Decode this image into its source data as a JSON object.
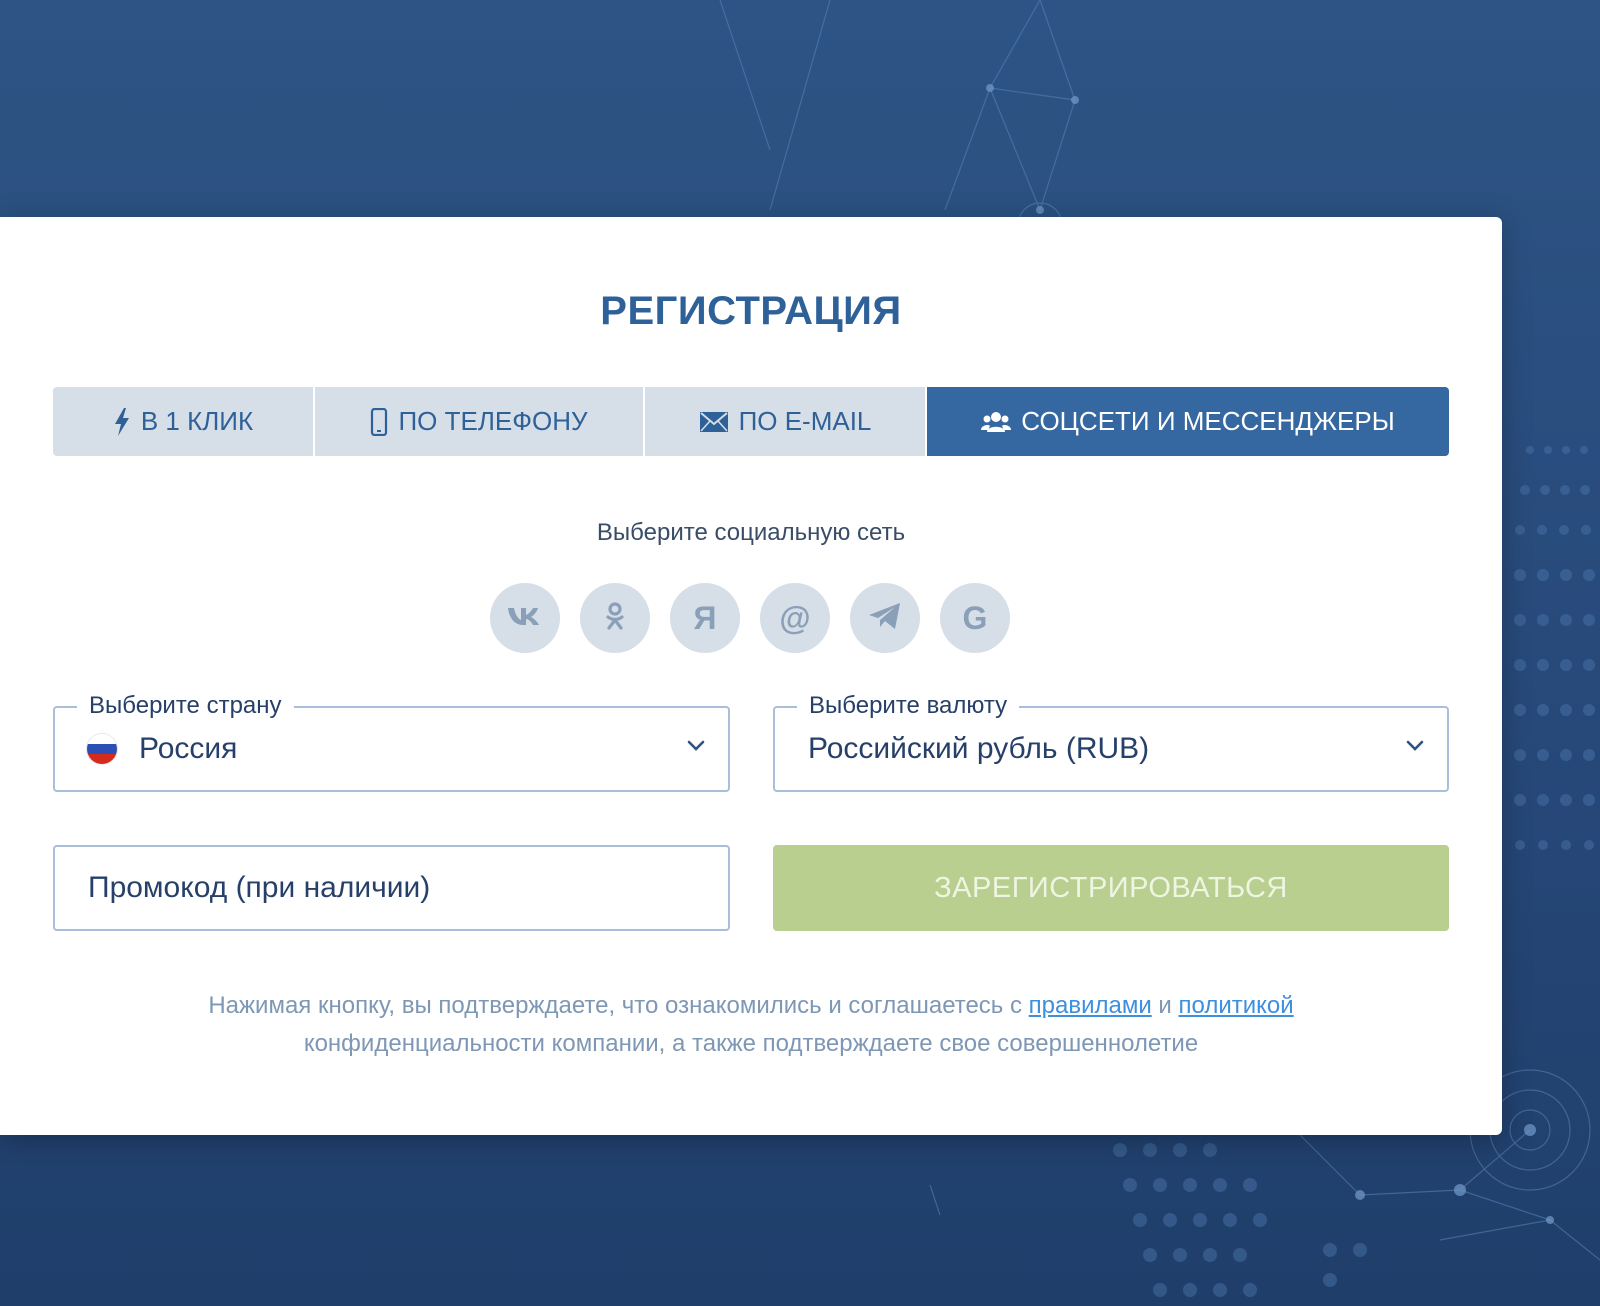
{
  "modal": {
    "title": "РЕГИСТРАЦИЯ"
  },
  "tabs": [
    {
      "label": "В 1 КЛИК",
      "icon": "lightning-icon",
      "active": false
    },
    {
      "label": "ПО ТЕЛЕФОНУ",
      "icon": "phone-icon",
      "active": false
    },
    {
      "label": "ПО E-MAIL",
      "icon": "envelope-icon",
      "active": false
    },
    {
      "label": "СОЦСЕТИ И МЕССЕНДЖЕРЫ",
      "icon": "users-icon",
      "active": true
    }
  ],
  "social": {
    "prompt": "Выберите социальную сеть",
    "networks": [
      {
        "icon": "vk-icon"
      },
      {
        "icon": "odnoklassniki-icon"
      },
      {
        "icon": "yandex-icon",
        "glyph": "Я"
      },
      {
        "icon": "mail-ru-icon",
        "glyph": "@"
      },
      {
        "icon": "telegram-icon"
      },
      {
        "icon": "google-icon",
        "glyph": "G"
      }
    ]
  },
  "country": {
    "legend": "Выберите страну",
    "value": "Россия",
    "flag_icon": "russia-flag-icon"
  },
  "currency": {
    "legend": "Выберите валюту",
    "value": "Российский рубль (RUB)"
  },
  "promo": {
    "placeholder": "Промокод (при наличии)"
  },
  "submit": {
    "label": "ЗАРЕГИСТРИРОВАТЬСЯ"
  },
  "legal": {
    "text_before": "Нажимая кнопку, вы подтверждаете, что ознакомились и соглашаетесь с ",
    "rules_link": "правилами",
    "and": " и ",
    "policy_link": "политикой",
    "text_after": " конфиденциальности компании, а также подтверждаете свое совершеннолетие"
  },
  "colors": {
    "background": "#2d5484",
    "accent": "#3567a1",
    "tab_inactive": "#d6dee8",
    "submit": "#b9cf8f",
    "link": "#3d8fe0"
  }
}
